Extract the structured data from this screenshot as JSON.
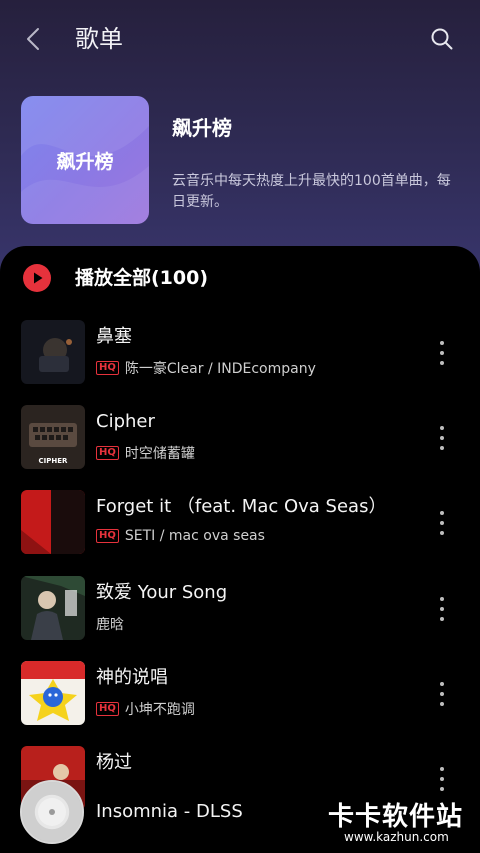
{
  "header": {
    "title": "歌单",
    "back_icon": "chevron-left-icon",
    "search_icon": "search-icon"
  },
  "playlist": {
    "cover_text": "飙升榜",
    "name": "飙升榜",
    "description": "云音乐中每天热度上升最快的100首单曲，每日更新。"
  },
  "play_all": {
    "label": "播放全部(100)",
    "icon": "play-circle-icon",
    "accent": "#e6323c"
  },
  "hq_badge": "HQ",
  "songs": [
    {
      "title": "鼻塞",
      "artist": "陈一豪Clear / INDEcompany",
      "hq": true
    },
    {
      "title": "Cipher",
      "artist": "时空储蓄罐",
      "hq": true,
      "art_text": "CIPHER"
    },
    {
      "title": "Forget it （feat. Mac Ova Seas）",
      "artist": "SETI / mac ova seas",
      "hq": true
    },
    {
      "title": "致爱 Your Song",
      "artist": "鹿晗",
      "hq": false
    },
    {
      "title": "神的说唱",
      "artist": "小坤不跑调",
      "hq": true
    },
    {
      "title": "杨过",
      "artist": "",
      "hq": false
    }
  ],
  "mini_player": {
    "now_playing": "Insomnia - DLSS"
  },
  "watermark": {
    "text": "卡卡软件站",
    "url": "www.kazhun.com"
  }
}
